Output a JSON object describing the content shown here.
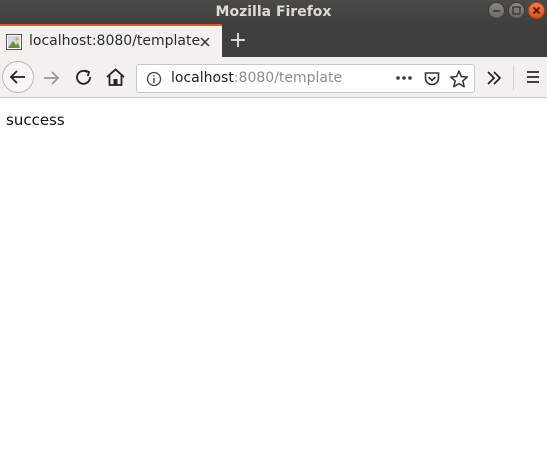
{
  "window": {
    "title": "Mozilla Firefox"
  },
  "tab": {
    "title": "localhost:8080/template"
  },
  "urlbar": {
    "host": "localhost",
    "rest": ":8080/template"
  },
  "page": {
    "text": "success"
  },
  "colors": {
    "accent": "#e95420",
    "titlebar": "#3f3f3b",
    "toolbar": "#f2f1ef"
  },
  "icons": [
    "minimize-icon",
    "maximize-icon",
    "close-icon",
    "favicon-icon",
    "tab-close-icon",
    "new-tab-icon",
    "back-icon",
    "forward-icon",
    "reload-icon",
    "home-icon",
    "info-icon",
    "page-actions-icon",
    "pocket-icon",
    "bookmark-star-icon",
    "overflow-icon",
    "menu-icon"
  ]
}
